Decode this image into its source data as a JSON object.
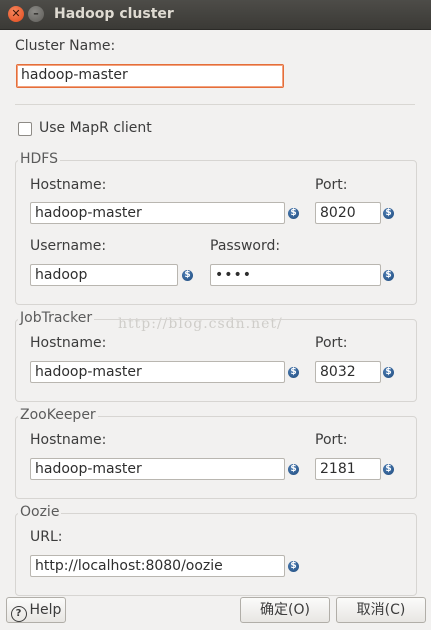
{
  "window": {
    "title": "Hadoop cluster",
    "close_glyph": "✕",
    "minimize_glyph": "–"
  },
  "cluster": {
    "name_label": "Cluster Name:",
    "name_value": "hadoop-master"
  },
  "mapr": {
    "label": "Use MapR client",
    "checked": false
  },
  "hdfs": {
    "group_label": "HDFS",
    "hostname_label": "Hostname:",
    "hostname_value": "hadoop-master",
    "port_label": "Port:",
    "port_value": "8020",
    "username_label": "Username:",
    "username_value": "hadoop",
    "password_label": "Password:",
    "password_value": "••••"
  },
  "jobtracker": {
    "group_label": "JobTracker",
    "hostname_label": "Hostname:",
    "hostname_value": "hadoop-master",
    "port_label": "Port:",
    "port_value": "8032"
  },
  "zookeeper": {
    "group_label": "ZooKeeper",
    "hostname_label": "Hostname:",
    "hostname_value": "hadoop-master",
    "port_label": "Port:",
    "port_value": "2181"
  },
  "oozie": {
    "group_label": "Oozie",
    "url_label": "URL:",
    "url_value": "http://localhost:8080/oozie"
  },
  "watermark": "http://blog.csdn.net/",
  "buttons": {
    "help": "Help",
    "help_glyph": "?",
    "ok": "确定(O)",
    "cancel": "取消(C)"
  },
  "variable_icon_glyph": "$",
  "colors": {
    "titlebar": "#3c3b37",
    "close_button": "#e95420",
    "focus_border": "#e46e3a",
    "variable_icon": "#2b5a8f"
  }
}
